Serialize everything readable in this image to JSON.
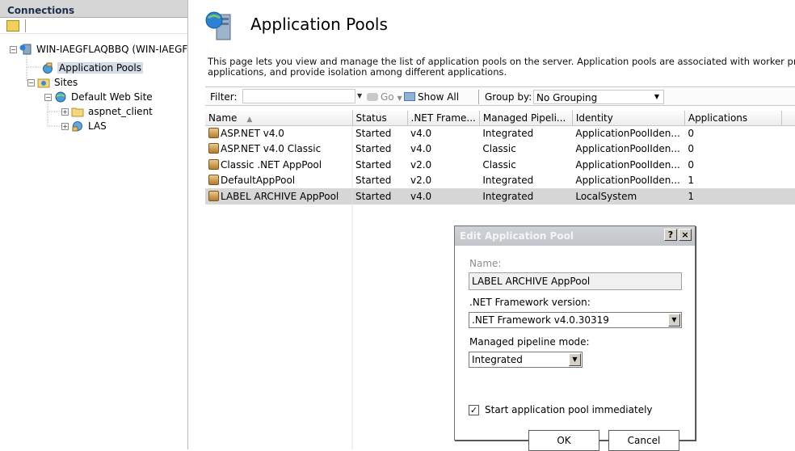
{
  "connections": {
    "header": "Connections",
    "tree": {
      "server": "WIN-IAEGFLAQBBQ (WIN-IAEGF",
      "app_pools": "Application Pools",
      "sites": "Sites",
      "default_site": "Default Web Site",
      "aspnet_client": "aspnet_client",
      "las": "LAS"
    }
  },
  "page": {
    "title": "Application Pools",
    "description_line1": "This page lets you view and manage the list of application pools on the server. Application pools are associated with worker proces:",
    "description_line2": "applications, and provide isolation among different applications."
  },
  "filterbar": {
    "filter_label": "Filter:",
    "filter_value": "",
    "go_label": "Go",
    "show_all_label": "Show All",
    "group_by_label": "Group by:",
    "group_by_value": "No Grouping"
  },
  "grid": {
    "columns": [
      "Name",
      "Status",
      ".NET Frame...",
      "Managed Pipeli...",
      "Identity",
      "Applications"
    ],
    "rows": [
      {
        "name": "ASP.NET v4.0",
        "status": "Started",
        "net": "v4.0",
        "pipeline": "Integrated",
        "identity": "ApplicationPoolIden...",
        "apps": "0"
      },
      {
        "name": "ASP.NET v4.0 Classic",
        "status": "Started",
        "net": "v4.0",
        "pipeline": "Classic",
        "identity": "ApplicationPoolIden...",
        "apps": "0"
      },
      {
        "name": "Classic .NET AppPool",
        "status": "Started",
        "net": "v2.0",
        "pipeline": "Classic",
        "identity": "ApplicationPoolIden...",
        "apps": "0"
      },
      {
        "name": "DefaultAppPool",
        "status": "Started",
        "net": "v2.0",
        "pipeline": "Integrated",
        "identity": "ApplicationPoolIden...",
        "apps": "1"
      },
      {
        "name": "LABEL ARCHIVE AppPool",
        "status": "Started",
        "net": "v4.0",
        "pipeline": "Integrated",
        "identity": "LocalSystem",
        "apps": "1"
      }
    ]
  },
  "dialog": {
    "title": "Edit Application Pool",
    "help": "?",
    "close": "×",
    "name_label": "Name:",
    "name_value": "LABEL ARCHIVE AppPool",
    "framework_label": ".NET Framework version:",
    "framework_value": ".NET Framework v4.0.30319",
    "pipeline_label": "Managed pipeline mode:",
    "pipeline_value": "Integrated",
    "start_label": "Start application pool immediately",
    "start_checked": true,
    "ok_label": "OK",
    "cancel_label": "Cancel"
  }
}
